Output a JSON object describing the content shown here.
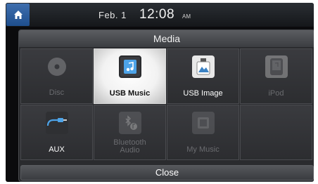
{
  "status_bar": {
    "date": "Feb.  1",
    "time": "12:08",
    "ampm": "AM"
  },
  "popup": {
    "title": "Media",
    "close_label": "Close",
    "items": [
      {
        "label": "Disc",
        "icon": "disc-icon",
        "enabled": false,
        "selected": false
      },
      {
        "label": "USB Music",
        "icon": "usb-music-icon",
        "enabled": true,
        "selected": true
      },
      {
        "label": "USB Image",
        "icon": "usb-image-icon",
        "enabled": true,
        "selected": false
      },
      {
        "label": "iPod",
        "icon": "ipod-icon",
        "enabled": false,
        "selected": false
      },
      {
        "label": "AUX",
        "icon": "aux-cable-icon",
        "enabled": true,
        "selected": false
      },
      {
        "label": "Bluetooth Audio",
        "icon": "bluetooth-audio-icon",
        "enabled": false,
        "selected": false
      },
      {
        "label": "My Music",
        "icon": "my-music-icon",
        "enabled": false,
        "selected": false
      }
    ]
  },
  "colors": {
    "home_button": "#2f5f9d",
    "selected_cell": "#f5f5f5",
    "disabled_text": "#6a6b6f"
  }
}
